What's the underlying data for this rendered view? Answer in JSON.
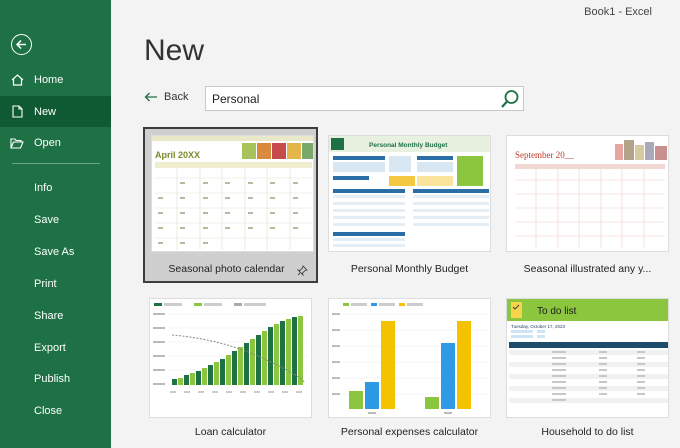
{
  "window": {
    "title": "Book1  -  Excel"
  },
  "sidebar": {
    "items": [
      {
        "label": "Home",
        "icon": "home-icon"
      },
      {
        "label": "New",
        "icon": "new-file-icon",
        "active": true
      },
      {
        "label": "Open",
        "icon": "folder-open-icon"
      },
      {
        "label": "Info"
      },
      {
        "label": "Save"
      },
      {
        "label": "Save As"
      },
      {
        "label": "Print"
      },
      {
        "label": "Share"
      },
      {
        "label": "Export"
      },
      {
        "label": "Publish"
      },
      {
        "label": "Close"
      }
    ]
  },
  "main": {
    "title": "New",
    "back_label": "Back",
    "search": {
      "value": "Personal",
      "placeholder": ""
    },
    "templates": [
      {
        "label": "Seasonal photo calendar",
        "selected": true
      },
      {
        "label": "Personal Monthly Budget"
      },
      {
        "label": "Seasonal illustrated any y..."
      },
      {
        "label": "Loan calculator"
      },
      {
        "label": "Personal expenses calculator"
      },
      {
        "label": "Household to do list"
      }
    ],
    "thumbs": {
      "calendar": {
        "month": "April 20XX"
      },
      "budget": {
        "title": "Personal Monthly Budget"
      },
      "seasonal": {
        "month": "September 20__"
      },
      "todo": {
        "title": "To do list",
        "date": "Tuesday, October 17, 2023"
      }
    }
  },
  "colors": {
    "sidebar": "#1e7145",
    "active": "#0f5a33",
    "accent_green": "#217346"
  }
}
